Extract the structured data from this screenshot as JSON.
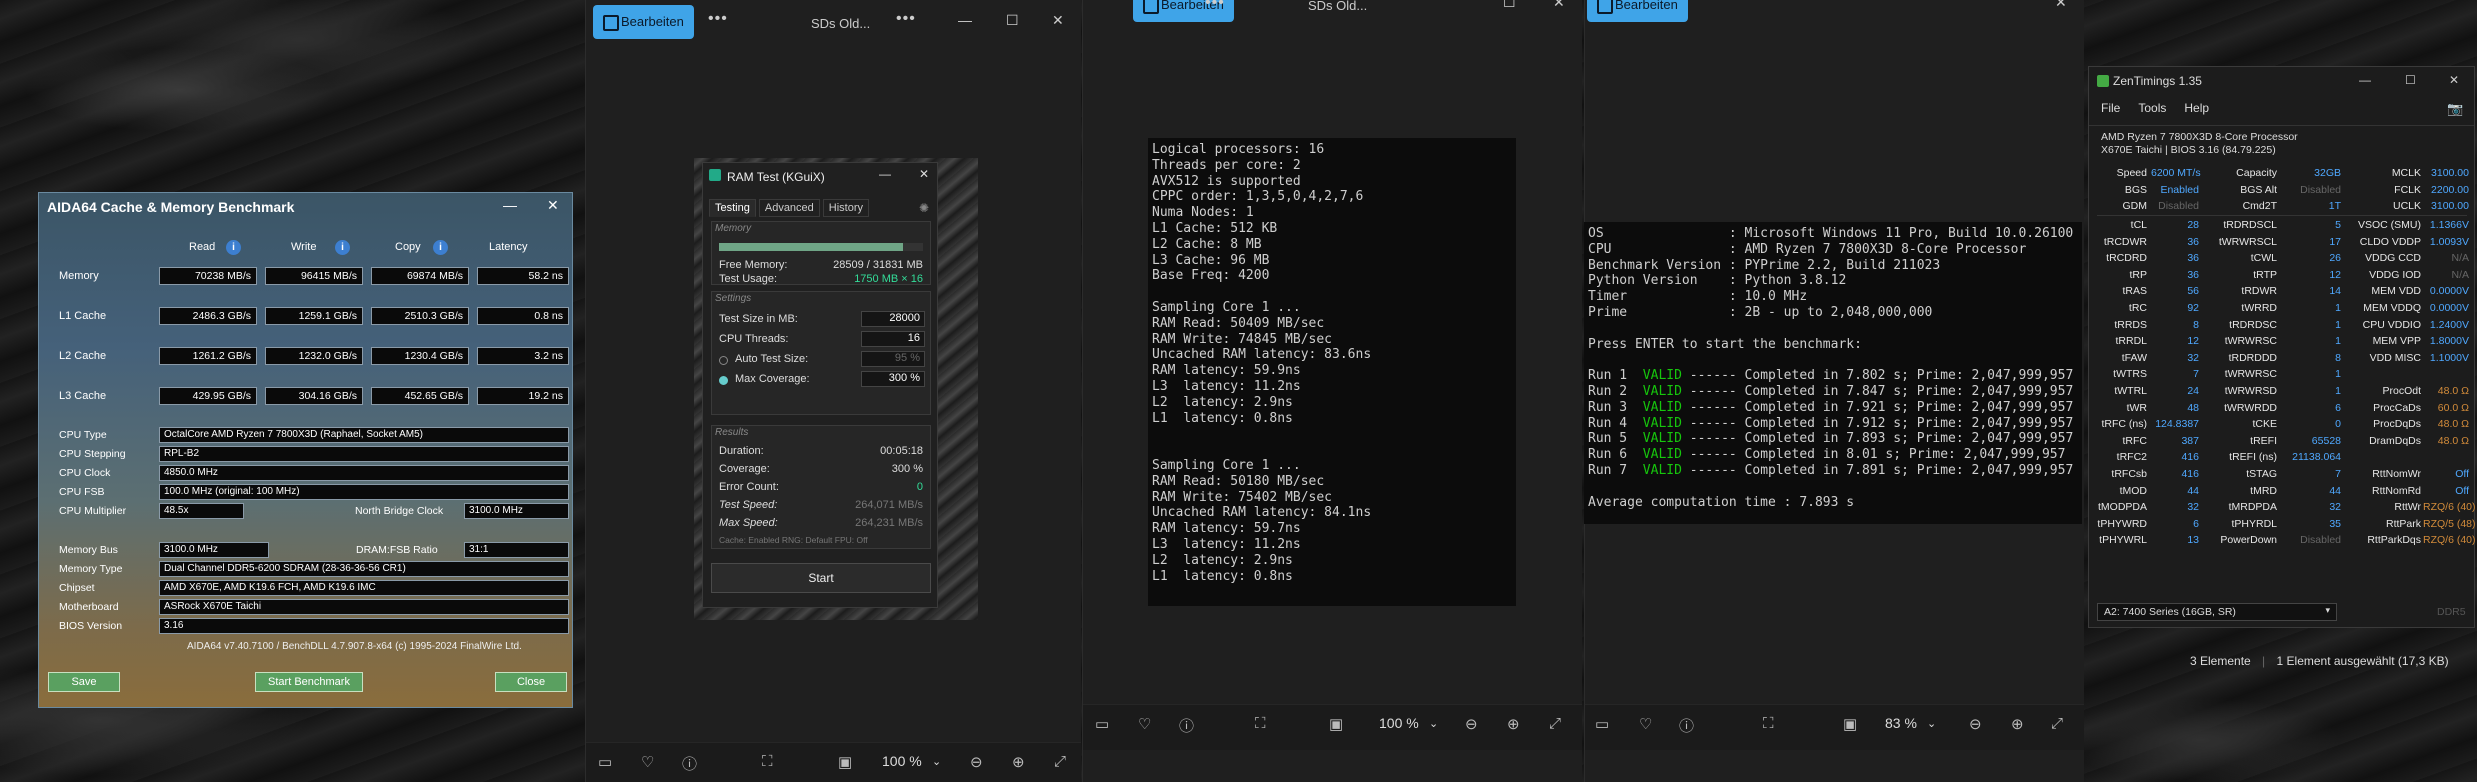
{
  "aida": {
    "title": "AIDA64 Cache & Memory Benchmark",
    "headers": [
      "Read",
      "Write",
      "Copy",
      "Latency"
    ],
    "rows": [
      {
        "label": "Memory",
        "read": "70238 MB/s",
        "write": "96415 MB/s",
        "copy": "69874 MB/s",
        "latency": "58.2 ns"
      },
      {
        "label": "L1 Cache",
        "read": "2486.3 GB/s",
        "write": "1259.1 GB/s",
        "copy": "2510.3 GB/s",
        "latency": "0.8 ns"
      },
      {
        "label": "L2 Cache",
        "read": "1261.2 GB/s",
        "write": "1232.0 GB/s",
        "copy": "1230.4 GB/s",
        "latency": "3.2 ns"
      },
      {
        "label": "L3 Cache",
        "read": "429.95 GB/s",
        "write": "304.16 GB/s",
        "copy": "452.65 GB/s",
        "latency": "19.2 ns"
      }
    ],
    "info": [
      {
        "label": "CPU Type",
        "value": "OctalCore AMD Ryzen 7 7800X3D  (Raphael, Socket AM5)"
      },
      {
        "label": "CPU Stepping",
        "value": "RPL-B2"
      },
      {
        "label": "CPU Clock",
        "value": "4850.0 MHz"
      },
      {
        "label": "CPU FSB",
        "value": "100.0 MHz  (original: 100 MHz)"
      },
      {
        "label": "CPU Multiplier",
        "value": "48.5x"
      }
    ],
    "nb_label": "North Bridge Clock",
    "nb_value": "3100.0 MHz",
    "mem_bus_label": "Memory Bus",
    "mem_bus": "3100.0 MHz",
    "dram_ratio_label": "DRAM:FSB Ratio",
    "dram_ratio": "31:1",
    "info2": [
      {
        "label": "Memory Type",
        "value": "Dual Channel DDR5-6200 SDRAM  (28-36-36-56 CR1)"
      },
      {
        "label": "Chipset",
        "value": "AMD X670E, AMD K19.6 FCH, AMD K19.6 IMC"
      },
      {
        "label": "Motherboard",
        "value": "ASRock X670E Taichi"
      },
      {
        "label": "BIOS Version",
        "value": "3.16"
      }
    ],
    "footer": "AIDA64 v7.40.7100 / BenchDLL 4.7.907.8-x64  (c) 1995-2024 FinalWire Ltd.",
    "save": "Save",
    "start": "Start Benchmark",
    "close": "Close"
  },
  "photo": {
    "edit_label": "Bearbeiten",
    "title": "SDs Old...",
    "zoom1": "100 %",
    "zoom2": "100 %",
    "zoom3": "83 %"
  },
  "ramtest": {
    "title": "RAM Test (KGuiX)",
    "tabs": [
      "Testing",
      "Advanced",
      "History"
    ],
    "memory_label": "Memory",
    "free_label": "Free Memory:",
    "free_value": "28509 / 31831 MB",
    "usage_label": "Test Usage:",
    "usage_value": "1750 MB × 16",
    "memory_used_fraction": 0.9,
    "settings_label": "Settings",
    "size_label": "Test Size in MB:",
    "size_value": "28000",
    "threads_label": "CPU Threads:",
    "threads_value": "16",
    "auto_label": "Auto Test Size:",
    "auto_value": "95 %",
    "max_label": "Max Coverage:",
    "max_value": "300 %",
    "results_label": "Results",
    "duration_label": "Duration:",
    "duration_value": "00:05:18",
    "coverage_label": "Coverage:",
    "coverage_value": "300 %",
    "errors_label": "Error Count:",
    "errors_value": "0",
    "speed_label": "Test Speed:",
    "speed_value": "264,071 MB/s",
    "maxspeed_label": "Max Speed:",
    "maxspeed_value": "264,231 MB/s",
    "footnote": "Cache: Enabled  RNG: Default  FPU: Off",
    "start": "Start"
  },
  "console1": [
    "Logical processors: 16",
    "Threads per core: 2",
    "AVX512 is supported",
    "CPPC order: 1,3,5,0,4,2,7,6",
    "Numa Nodes: 1",
    "L1 Cache: 512 KB",
    "L2 Cache: 8 MB",
    "L3 Cache: 96 MB",
    "Base Freq: 4200",
    "",
    "Sampling Core 1 ...",
    "RAM Read: 50409 MB/sec",
    "RAM Write: 74845 MB/sec",
    "Uncached RAM latency: 83.6ns",
    "RAM latency: 59.9ns",
    "L3  latency: 11.2ns",
    "L2  latency: 2.9ns",
    "L1  latency: 0.8ns",
    "",
    "",
    "Sampling Core 1 ...",
    "RAM Read: 50180 MB/sec",
    "RAM Write: 75402 MB/sec",
    "Uncached RAM latency: 84.1ns",
    "RAM latency: 59.7ns",
    "L3  latency: 11.2ns",
    "L2  latency: 2.9ns",
    "L1  latency: 0.8ns"
  ],
  "console2": {
    "header": [
      "OS                : Microsoft Windows 11 Pro, Build 10.0.26100",
      "CPU               : AMD Ryzen 7 7800X3D 8-Core Processor",
      "Benchmark Version : PYPrime 2.2, Build 211023",
      "Python Version    : Python 3.8.12",
      "Timer             : 10.0 MHz",
      "Prime             : 2B - up to 2,048,000,000"
    ],
    "prompt": "Press ENTER to start the benchmark:",
    "runs": [
      {
        "run": "Run 1",
        "status": "VALID",
        "rest": " ------ Completed in 7.802 s; Prime: 2,047,999,957"
      },
      {
        "run": "Run 2",
        "status": "VALID",
        "rest": " ------ Completed in 7.847 s; Prime: 2,047,999,957"
      },
      {
        "run": "Run 3",
        "status": "VALID",
        "rest": " ------ Completed in 7.921 s; Prime: 2,047,999,957"
      },
      {
        "run": "Run 4",
        "status": "VALID",
        "rest": " ------ Completed in 7.912 s; Prime: 2,047,999,957"
      },
      {
        "run": "Run 5",
        "status": "VALID",
        "rest": " ------ Completed in 7.893 s; Prime: 2,047,999,957"
      },
      {
        "run": "Run 6",
        "status": "VALID",
        "rest": " ------ Completed in 8.01 s; Prime: 2,047,999,957"
      },
      {
        "run": "Run 7",
        "status": "VALID",
        "rest": " ------ Completed in 7.891 s; Prime: 2,047,999,957"
      }
    ],
    "average": "Average computation time : 7.893 s"
  },
  "zen": {
    "title": "ZenTimings 1.35",
    "menu": [
      "File",
      "Tools",
      "Help"
    ],
    "cpu": "AMD Ryzen 7 7800X3D 8-Core Processor",
    "board": "X670E Taichi | BIOS 3.16 (84.79.225)",
    "top": [
      [
        "Speed",
        "6200 MT/s",
        "Capacity",
        "32GB",
        "MCLK",
        "3100.00"
      ],
      [
        "BGS",
        "Enabled",
        "BGS Alt",
        "Disabled",
        "FCLK",
        "2200.00"
      ],
      [
        "GDM",
        "Disabled",
        "Cmd2T",
        "1T",
        "UCLK",
        "3100.00"
      ]
    ],
    "grid": [
      [
        "tCL",
        "28",
        "tRDRDSCL",
        "5",
        "VSOC (SMU)",
        "1.1366V"
      ],
      [
        "tRCDWR",
        "36",
        "tWRWRSCL",
        "17",
        "CLDO VDDP",
        "1.0093V"
      ],
      [
        "tRCDRD",
        "36",
        "tCWL",
        "26",
        "VDDG CCD",
        "N/A"
      ],
      [
        "tRP",
        "36",
        "tRTP",
        "12",
        "VDDG IOD",
        "N/A"
      ],
      [
        "tRAS",
        "56",
        "tRDWR",
        "14",
        "MEM VDD",
        "0.0000V"
      ],
      [
        "tRC",
        "92",
        "tWRRD",
        "1",
        "MEM VDDQ",
        "0.0000V"
      ],
      [
        "tRRDS",
        "8",
        "tRDRDSC",
        "1",
        "CPU VDDIO",
        "1.2400V"
      ],
      [
        "tRRDL",
        "12",
        "tWRWRSC",
        "1",
        "MEM VPP",
        "1.8000V"
      ],
      [
        "tFAW",
        "32",
        "tRDRDDD",
        "8",
        "VDD MISC",
        "1.1000V"
      ],
      [
        "tWTRS",
        "7",
        "tWRWRSC",
        "1",
        "",
        ""
      ],
      [
        "tWTRL",
        "24",
        "tWRWRSD",
        "1",
        "ProcOdt",
        "48.0 Ω"
      ],
      [
        "tWR",
        "48",
        "tWRWRDD",
        "6",
        "ProcCaDs",
        "60.0 Ω"
      ],
      [
        "tRFC (ns)",
        "124.8387",
        "tCKE",
        "0",
        "ProcDqDs",
        "48.0 Ω"
      ],
      [
        "tRFC",
        "387",
        "tREFI",
        "65528",
        "DramDqDs",
        "48.0 Ω"
      ],
      [
        "tRFC2",
        "416",
        "tREFI (ns)",
        "21138.064",
        "",
        ""
      ],
      [
        "tRFCsb",
        "416",
        "tSTAG",
        "7",
        "RttNomWr",
        "Off"
      ],
      [
        "tMOD",
        "44",
        "tMRD",
        "44",
        "RttNomRd",
        "Off"
      ],
      [
        "tMODPDA",
        "32",
        "tMRDPDA",
        "32",
        "RttWr",
        "RZQ/6 (40)"
      ],
      [
        "tPHYWRD",
        "6",
        "tPHYRDL",
        "35",
        "RttPark",
        "RZQ/5 (48)"
      ],
      [
        "tPHYWRL",
        "13",
        "PowerDown",
        "Disabled",
        "RttParkDqs",
        "RZQ/6 (40)"
      ]
    ],
    "dimm": "A2: 7400 Series (16GB, SR)",
    "ddr": "DDR5"
  },
  "status": {
    "items": "3 Elemente",
    "selected": "1 Element ausgewählt (17,3 KB)"
  }
}
